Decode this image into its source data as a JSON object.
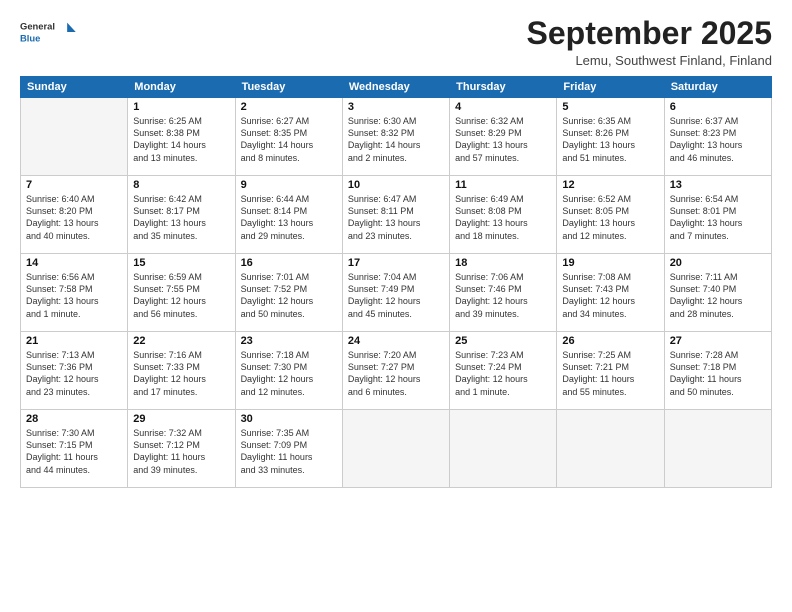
{
  "header": {
    "logo_line1": "General",
    "logo_line2": "Blue",
    "title": "September 2025",
    "subtitle": "Lemu, Southwest Finland, Finland"
  },
  "days_of_week": [
    "Sunday",
    "Monday",
    "Tuesday",
    "Wednesday",
    "Thursday",
    "Friday",
    "Saturday"
  ],
  "weeks": [
    [
      {
        "day": "",
        "info": ""
      },
      {
        "day": "1",
        "info": "Sunrise: 6:25 AM\nSunset: 8:38 PM\nDaylight: 14 hours\nand 13 minutes."
      },
      {
        "day": "2",
        "info": "Sunrise: 6:27 AM\nSunset: 8:35 PM\nDaylight: 14 hours\nand 8 minutes."
      },
      {
        "day": "3",
        "info": "Sunrise: 6:30 AM\nSunset: 8:32 PM\nDaylight: 14 hours\nand 2 minutes."
      },
      {
        "day": "4",
        "info": "Sunrise: 6:32 AM\nSunset: 8:29 PM\nDaylight: 13 hours\nand 57 minutes."
      },
      {
        "day": "5",
        "info": "Sunrise: 6:35 AM\nSunset: 8:26 PM\nDaylight: 13 hours\nand 51 minutes."
      },
      {
        "day": "6",
        "info": "Sunrise: 6:37 AM\nSunset: 8:23 PM\nDaylight: 13 hours\nand 46 minutes."
      }
    ],
    [
      {
        "day": "7",
        "info": "Sunrise: 6:40 AM\nSunset: 8:20 PM\nDaylight: 13 hours\nand 40 minutes."
      },
      {
        "day": "8",
        "info": "Sunrise: 6:42 AM\nSunset: 8:17 PM\nDaylight: 13 hours\nand 35 minutes."
      },
      {
        "day": "9",
        "info": "Sunrise: 6:44 AM\nSunset: 8:14 PM\nDaylight: 13 hours\nand 29 minutes."
      },
      {
        "day": "10",
        "info": "Sunrise: 6:47 AM\nSunset: 8:11 PM\nDaylight: 13 hours\nand 23 minutes."
      },
      {
        "day": "11",
        "info": "Sunrise: 6:49 AM\nSunset: 8:08 PM\nDaylight: 13 hours\nand 18 minutes."
      },
      {
        "day": "12",
        "info": "Sunrise: 6:52 AM\nSunset: 8:05 PM\nDaylight: 13 hours\nand 12 minutes."
      },
      {
        "day": "13",
        "info": "Sunrise: 6:54 AM\nSunset: 8:01 PM\nDaylight: 13 hours\nand 7 minutes."
      }
    ],
    [
      {
        "day": "14",
        "info": "Sunrise: 6:56 AM\nSunset: 7:58 PM\nDaylight: 13 hours\nand 1 minute."
      },
      {
        "day": "15",
        "info": "Sunrise: 6:59 AM\nSunset: 7:55 PM\nDaylight: 12 hours\nand 56 minutes."
      },
      {
        "day": "16",
        "info": "Sunrise: 7:01 AM\nSunset: 7:52 PM\nDaylight: 12 hours\nand 50 minutes."
      },
      {
        "day": "17",
        "info": "Sunrise: 7:04 AM\nSunset: 7:49 PM\nDaylight: 12 hours\nand 45 minutes."
      },
      {
        "day": "18",
        "info": "Sunrise: 7:06 AM\nSunset: 7:46 PM\nDaylight: 12 hours\nand 39 minutes."
      },
      {
        "day": "19",
        "info": "Sunrise: 7:08 AM\nSunset: 7:43 PM\nDaylight: 12 hours\nand 34 minutes."
      },
      {
        "day": "20",
        "info": "Sunrise: 7:11 AM\nSunset: 7:40 PM\nDaylight: 12 hours\nand 28 minutes."
      }
    ],
    [
      {
        "day": "21",
        "info": "Sunrise: 7:13 AM\nSunset: 7:36 PM\nDaylight: 12 hours\nand 23 minutes."
      },
      {
        "day": "22",
        "info": "Sunrise: 7:16 AM\nSunset: 7:33 PM\nDaylight: 12 hours\nand 17 minutes."
      },
      {
        "day": "23",
        "info": "Sunrise: 7:18 AM\nSunset: 7:30 PM\nDaylight: 12 hours\nand 12 minutes."
      },
      {
        "day": "24",
        "info": "Sunrise: 7:20 AM\nSunset: 7:27 PM\nDaylight: 12 hours\nand 6 minutes."
      },
      {
        "day": "25",
        "info": "Sunrise: 7:23 AM\nSunset: 7:24 PM\nDaylight: 12 hours\nand 1 minute."
      },
      {
        "day": "26",
        "info": "Sunrise: 7:25 AM\nSunset: 7:21 PM\nDaylight: 11 hours\nand 55 minutes."
      },
      {
        "day": "27",
        "info": "Sunrise: 7:28 AM\nSunset: 7:18 PM\nDaylight: 11 hours\nand 50 minutes."
      }
    ],
    [
      {
        "day": "28",
        "info": "Sunrise: 7:30 AM\nSunset: 7:15 PM\nDaylight: 11 hours\nand 44 minutes."
      },
      {
        "day": "29",
        "info": "Sunrise: 7:32 AM\nSunset: 7:12 PM\nDaylight: 11 hours\nand 39 minutes."
      },
      {
        "day": "30",
        "info": "Sunrise: 7:35 AM\nSunset: 7:09 PM\nDaylight: 11 hours\nand 33 minutes."
      },
      {
        "day": "",
        "info": ""
      },
      {
        "day": "",
        "info": ""
      },
      {
        "day": "",
        "info": ""
      },
      {
        "day": "",
        "info": ""
      }
    ]
  ]
}
